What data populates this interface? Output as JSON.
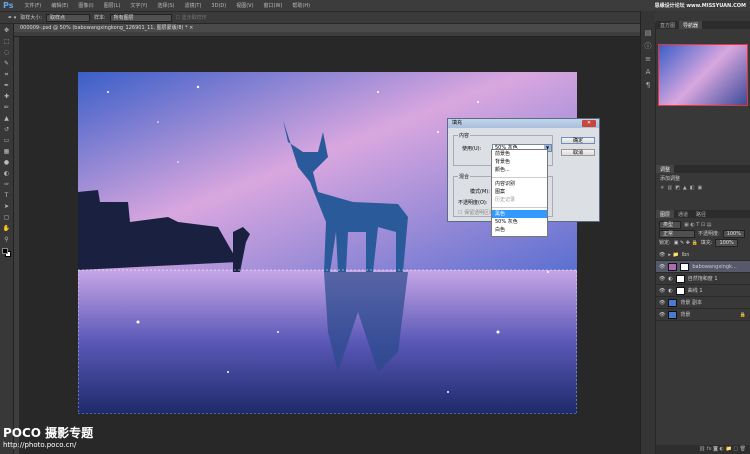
{
  "app": {
    "logo": "Ps"
  },
  "menu": [
    "文件(F)",
    "编辑(E)",
    "图像(I)",
    "图层(L)",
    "文字(Y)",
    "选择(S)",
    "滤镜(T)",
    "3D(D)",
    "视图(V)",
    "窗口(W)",
    "帮助(H)"
  ],
  "options": {
    "sample_size_label": "取样大小:",
    "sample_size": "取样点",
    "sample_label": "样本:",
    "sample": "所有图层",
    "show_ring": "显示取样环"
  },
  "document": {
    "tab": "000009-.psd @ 50% (babowangxingkong_126901_11, 图层蒙版/8) *"
  },
  "dialog": {
    "title": "填充",
    "contents_legend": "内容",
    "use_label": "使用(U):",
    "use_value": "50% 灰色",
    "ok": "确定",
    "cancel": "取消",
    "blend_legend": "混合",
    "mode_label": "模式(M):",
    "opacity_label": "不透明度(O):",
    "preserve": "保留透明区域(P)",
    "options": [
      {
        "label": "前景色"
      },
      {
        "label": "背景色"
      },
      {
        "label": "颜色..."
      },
      {
        "sep": true
      },
      {
        "label": "内容识别"
      },
      {
        "label": "图案"
      },
      {
        "label": "历史记录",
        "disabled": true
      },
      {
        "sep": true
      },
      {
        "label": "黑色",
        "selected": true
      },
      {
        "label": "50% 灰色"
      },
      {
        "label": "白色"
      }
    ]
  },
  "panels": {
    "nav_tabs": [
      "直方图",
      "导航器"
    ],
    "adj_tab": "调整",
    "adj_hint": "添加调整",
    "layer_tabs": [
      "图层",
      "通道",
      "路径"
    ],
    "kind": "类型",
    "blend": "正常",
    "opacity_label": "不透明度:",
    "opacity": "100%",
    "lock_label": "锁定:",
    "fill_label": "填充:",
    "fill": "100%",
    "layers": [
      {
        "name": "lbn",
        "group": true
      },
      {
        "name": "babowangxingk...",
        "selected": true
      },
      {
        "name": "自然饱和度 1"
      },
      {
        "name": "曲线 1"
      },
      {
        "name": "背景 副本"
      },
      {
        "name": "背景",
        "locked": true
      }
    ]
  },
  "watermarks": {
    "site": "思缘设计论坛 www.MISSYUAN.COM",
    "poco": "POCO 摄影专题",
    "poco_url": "http://photo.poco.cn/"
  }
}
